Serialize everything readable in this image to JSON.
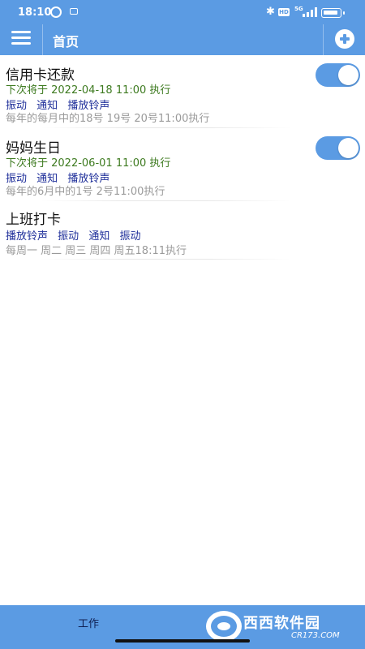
{
  "status_bar": {
    "time": "18:10",
    "network": "5G"
  },
  "header": {
    "title": "首页"
  },
  "reminders": [
    {
      "title": "信用卡还款",
      "next_run": "下次将于 2022-04-18 11:00 执行",
      "actions": [
        "振动",
        "通知",
        "播放铃声"
      ],
      "schedule": "每年的每月中的18号 19号 20号11:00执行",
      "enabled": true
    },
    {
      "title": "妈妈生日",
      "next_run": "下次将于 2022-06-01 11:00 执行",
      "actions": [
        "振动",
        "通知",
        "播放铃声"
      ],
      "schedule": "每年的6月中的1号 2号11:00执行",
      "enabled": true
    },
    {
      "title": "上班打卡",
      "next_run": "",
      "actions": [
        "播放铃声",
        "振动",
        "通知",
        "振动"
      ],
      "schedule": "每周一 周二 周三 周四 周五18:11执行",
      "enabled": null
    }
  ],
  "bottom_nav": {
    "work_label": "工作"
  },
  "watermark": {
    "brand": "西西软件园",
    "domain": "CR173.COM"
  },
  "colors": {
    "primary": "#5b9be3",
    "next_run_text": "#3d7a1f",
    "action_text": "#1f2f9a",
    "schedule_text": "#9a9a9a"
  }
}
